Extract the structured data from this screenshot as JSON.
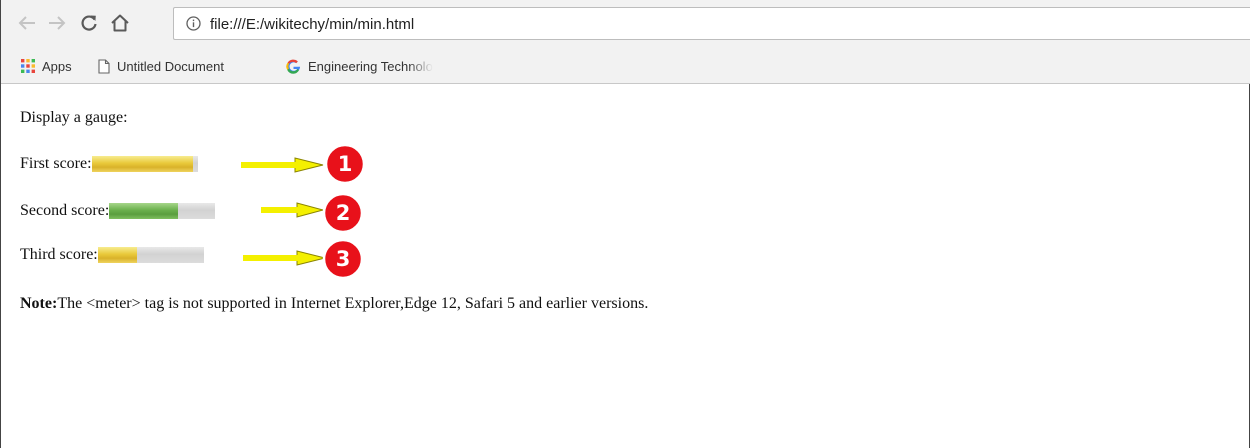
{
  "browser": {
    "url": "file:///E:/wikitechy/min/min.html",
    "bookmarks": [
      {
        "label": "Apps",
        "icon": "apps-grid-icon"
      },
      {
        "label": "Untitled Document",
        "icon": "document-icon"
      },
      {
        "label": "Engineering Technolo",
        "icon": "google-icon"
      }
    ]
  },
  "page": {
    "intro": "Display a gauge:",
    "meters": [
      {
        "label": "First score:",
        "value": 0.96,
        "color": "#e9c93a"
      },
      {
        "label": "Second score:",
        "value": 0.65,
        "color": "#6ab04c"
      },
      {
        "label": "Third score:",
        "value": 0.37,
        "color": "#e9c93a"
      }
    ],
    "note_label": "Note:",
    "note_text": "The <meter> tag is not supported in Internet Explorer,Edge 12, Safari 5 and earlier versions."
  },
  "annotations": [
    {
      "number": "1"
    },
    {
      "number": "2"
    },
    {
      "number": "3"
    }
  ],
  "colors": {
    "badge": "#e8111a",
    "arrow": "#f4f000"
  }
}
